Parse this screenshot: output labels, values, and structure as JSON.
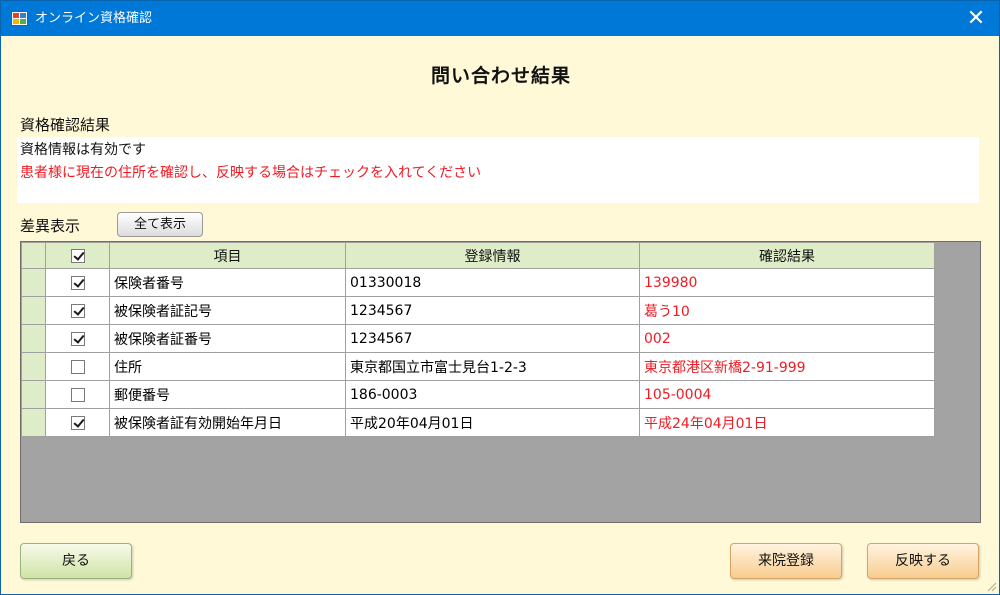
{
  "window": {
    "title": "オンライン資格確認",
    "close_glyph": "✕"
  },
  "page_title": "問い合わせ結果",
  "result": {
    "section_label": "資格確認結果",
    "line1": "資格情報は有効です",
    "line2": "患者様に現在の住所を確認し、反映する場合はチェックを入れてください"
  },
  "diff": {
    "label": "差異表示",
    "show_all_label": "全て表示",
    "header_checked": true,
    "columns": [
      "項目",
      "登録情報",
      "確認結果"
    ],
    "rows": [
      {
        "checked": true,
        "item": "保険者番号",
        "registered": "01330018",
        "confirmed": "139980"
      },
      {
        "checked": true,
        "item": "被保険者証記号",
        "registered": "1234567",
        "confirmed": "葛う10"
      },
      {
        "checked": true,
        "item": "被保険者証番号",
        "registered": "1234567",
        "confirmed": "002"
      },
      {
        "checked": false,
        "item": "住所",
        "registered": "東京都国立市富士見台1-2-3",
        "confirmed": "東京都港区新橋2-91-999"
      },
      {
        "checked": false,
        "item": "郵便番号",
        "registered": "186-0003",
        "confirmed": "105-0004"
      },
      {
        "checked": true,
        "item": "被保険者証有効開始年月日",
        "registered": "平成20年04月01日",
        "confirmed": "平成24年04月01日"
      }
    ]
  },
  "buttons": {
    "back": "戻る",
    "visit_register": "来院登録",
    "apply": "反映する"
  },
  "colors": {
    "titlebar": "#0078d7",
    "background": "#fff9d8",
    "header": "#dfecc8",
    "diff_red": "#ee1c25"
  }
}
